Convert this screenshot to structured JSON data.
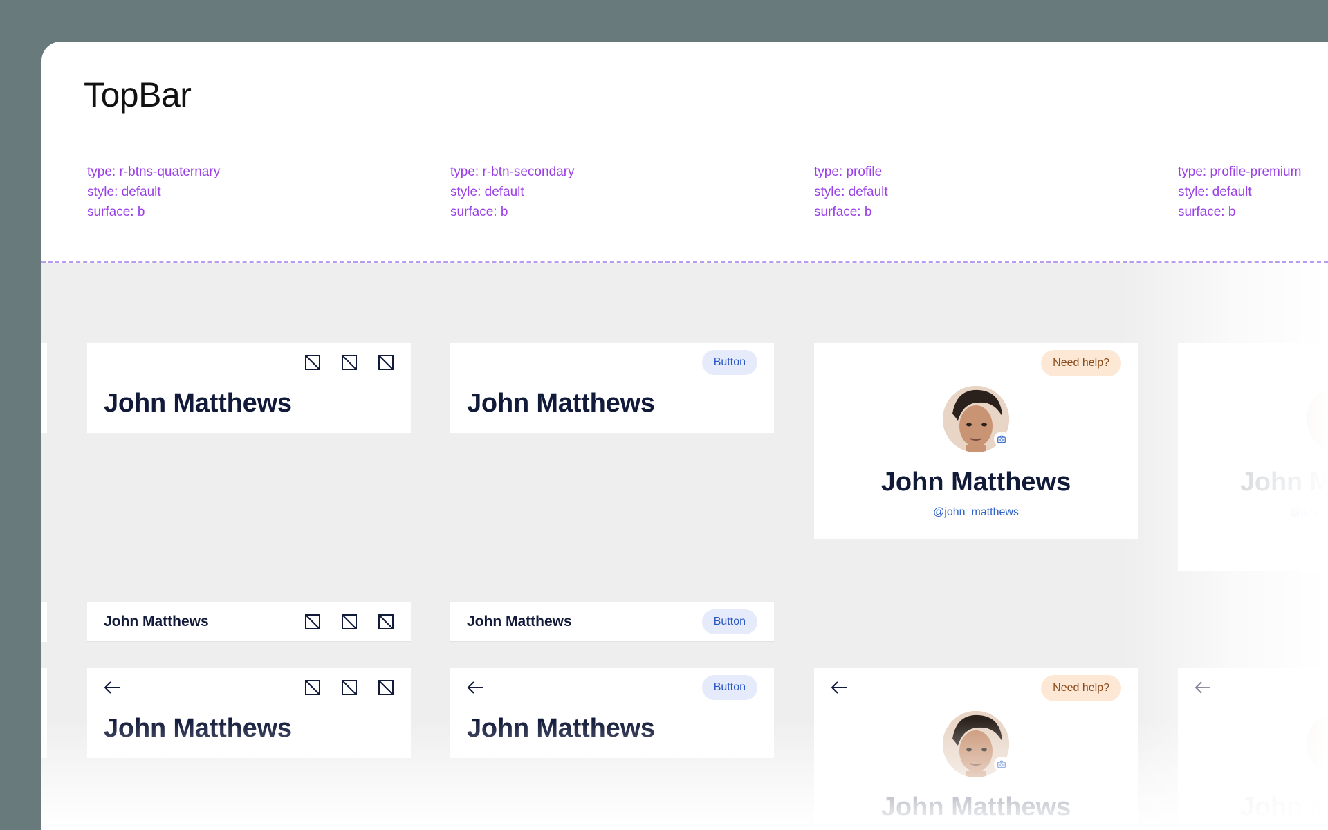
{
  "page": {
    "title": "TopBar"
  },
  "meta": [
    {
      "type": "type: r-btns-quaternary",
      "style": "style: default",
      "surface": "surface: b"
    },
    {
      "type": "type: r-btn-secondary",
      "style": "style: default",
      "surface": "surface: b"
    },
    {
      "type": "type: profile",
      "style": "style: default",
      "surface": "surface: b"
    },
    {
      "type": "type: profile-premium",
      "style": "style: default",
      "surface": "surface: b"
    }
  ],
  "user": {
    "name": "John Matthews",
    "handle": "@john_matthews",
    "name_cut": "John M",
    "handle_cut": "@joh"
  },
  "buttons": {
    "secondary": "Button",
    "help": "Need help?"
  },
  "icons": {
    "placeholder": "placeholder-icon",
    "back": "arrow-left-icon",
    "camera": "camera-icon"
  },
  "colors": {
    "meta_text": "#9a40e6",
    "name_text": "#121a3a",
    "secondary_btn_bg": "#e6ebfb",
    "secondary_btn_text": "#2a56c4",
    "help_btn_bg": "#fde8d6",
    "help_btn_text": "#8a4b1c",
    "handle_text": "#2f63c7"
  }
}
